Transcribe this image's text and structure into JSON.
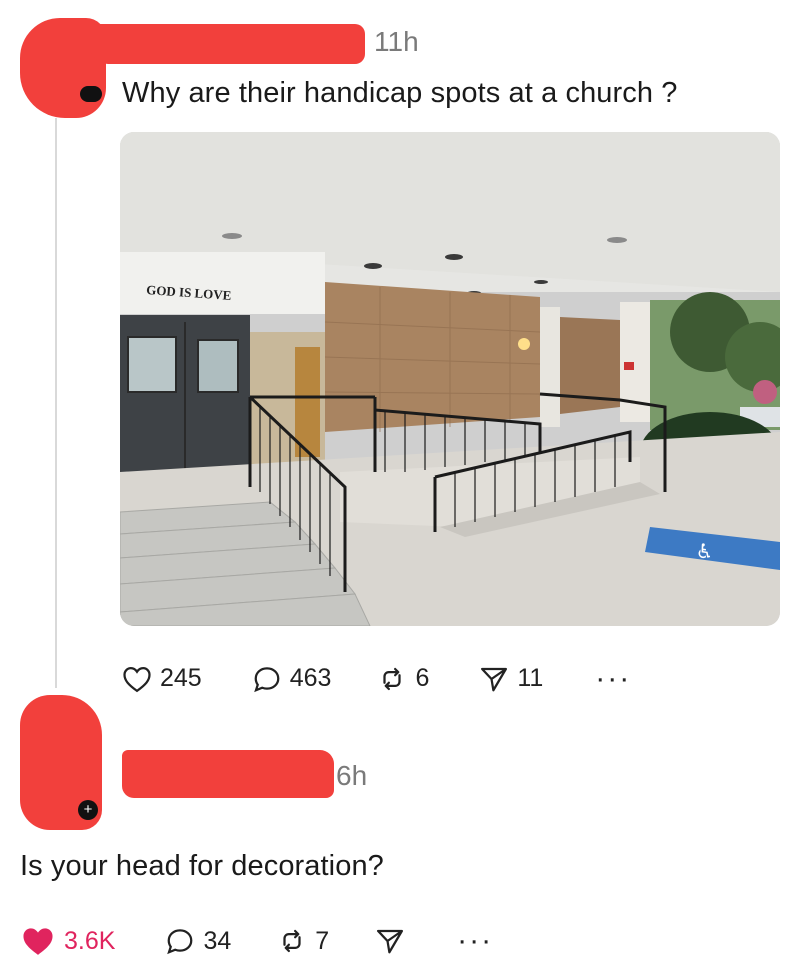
{
  "post": {
    "time": "11h",
    "text": "Why are their handicap spots at a church ?",
    "image": {
      "sign_text": "GOD IS LOVE",
      "colors": {
        "ceiling": "#e4e4e2",
        "stone": "#a98461",
        "ground": "#d9d6d0",
        "rail": "#1b1b1b",
        "door": "#3e4246",
        "parking_sign": "#3d7ac4"
      }
    },
    "actions": {
      "likes": "245",
      "comments": "463",
      "reposts": "6",
      "shares": "11",
      "more": "···"
    }
  },
  "reply": {
    "time": "6h",
    "text": "Is your head for decoration?",
    "actions": {
      "likes": "3.6K",
      "comments": "34",
      "reposts": "7",
      "more": "···"
    }
  },
  "icons": [
    "heart-icon",
    "comment-icon",
    "repost-icon",
    "send-icon",
    "more-icon"
  ],
  "colors": {
    "redaction": "#f2403c",
    "like_active": "#e0245e",
    "meta_gray": "#7a7a7a",
    "thread_line": "#d9d9d9"
  }
}
